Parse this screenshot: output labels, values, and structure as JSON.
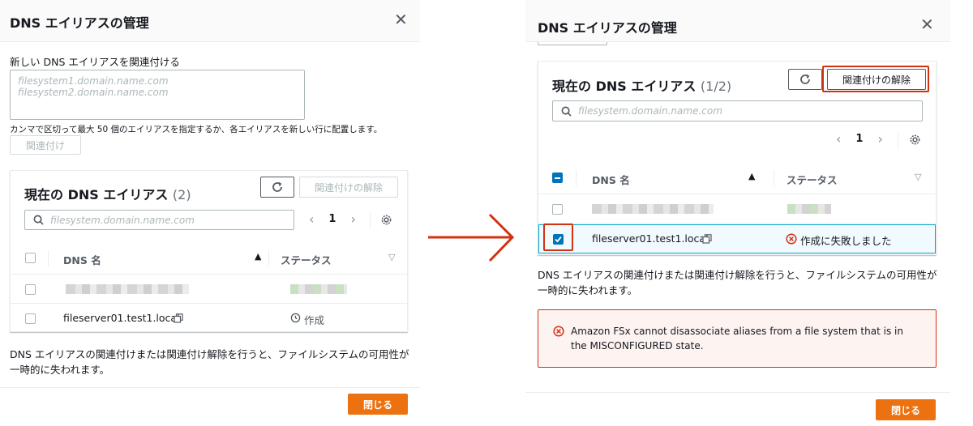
{
  "left": {
    "title": "DNS エイリアスの管理",
    "new_alias_label": "新しい DNS エイリアスを関連付ける",
    "textarea_placeholder": "filesystem1.domain.name.com filesystem2.domain.name.com",
    "hint": "カンマで区切って最大 50 個のエイリアスを指定するか、各エイリアスを新しい行に配置します。",
    "associate_button": "関連付け",
    "panel_title": "現在の DNS エイリアス",
    "panel_count": "(2)",
    "disassociate_button": "関連付けの解除",
    "search_placeholder": "filesystem.domain.name.com",
    "page": "1",
    "col_name": "DNS 名",
    "col_status": "ステータス",
    "rows": [
      {
        "name": "",
        "status": ""
      },
      {
        "name": "fileserver01.test1.local",
        "status": "作成"
      }
    ],
    "note": "DNS エイリアスの関連付けまたは関連付け解除を行うと、ファイルシステムの可用性が一時的に失われます。",
    "close_button": "閉じる"
  },
  "right": {
    "title": "DNS エイリアスの管理",
    "panel_title": "現在の DNS エイリアス",
    "panel_count": "(1/2)",
    "disassociate_button": "関連付けの解除",
    "search_placeholder": "filesystem.domain.name.com",
    "page": "1",
    "col_name": "DNS 名",
    "col_status": "ステータス",
    "rows": [
      {
        "name": "",
        "status": ""
      },
      {
        "name": "fileserver01.test1.local",
        "status": "作成に失敗しました"
      }
    ],
    "note": "DNS エイリアスの関連付けまたは関連付け解除を行うと、ファイルシステムの可用性が一時的に失われます。",
    "error": "Amazon FSx cannot disassociate aliases from a file system that is in the MISCONFIGURED state.",
    "close_button": "閉じる"
  },
  "colors": {
    "accent": "#ec7211",
    "highlight": "#d13212",
    "selected": "#0073bb"
  }
}
